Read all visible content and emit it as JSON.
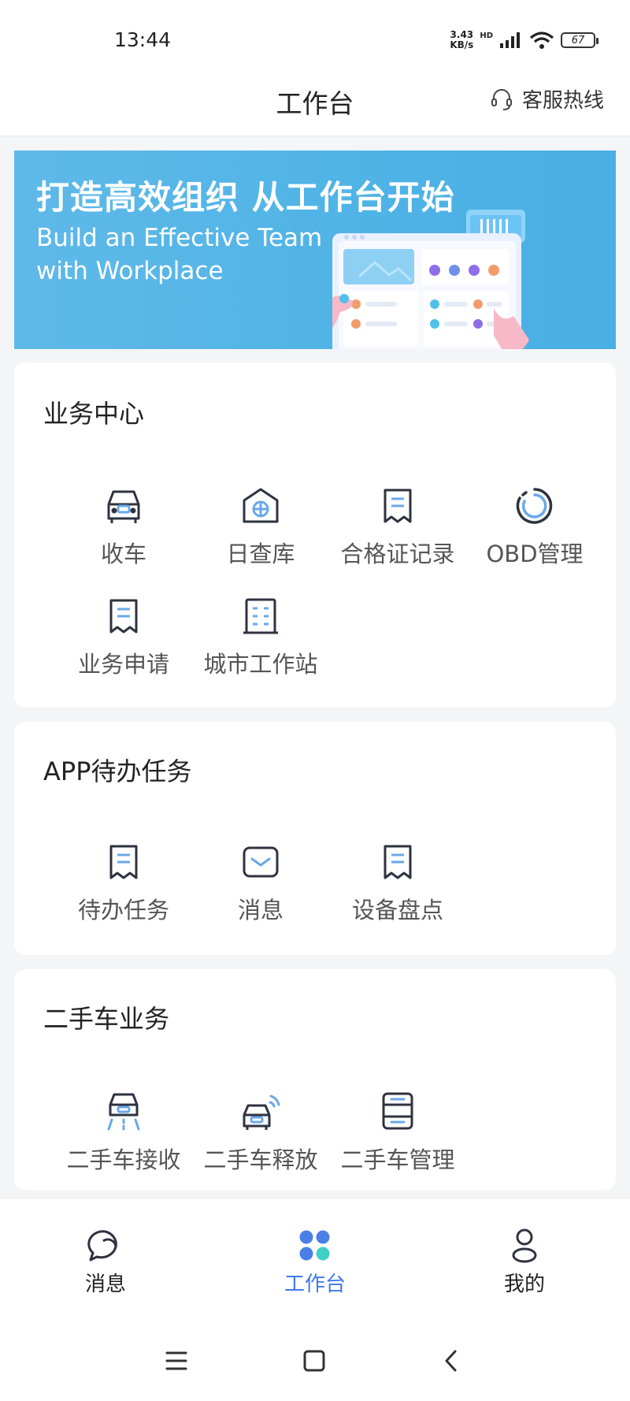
{
  "status": {
    "time": "13:44",
    "net_speed_value": "3.43",
    "net_speed_unit": "KB/s",
    "hd": "HD",
    "battery": "67"
  },
  "header": {
    "title": "工作台",
    "hotline_label": "客服热线",
    "hotline_icon": "headset-icon"
  },
  "banner": {
    "title": "打造高效组织 从工作台开始",
    "subtitle": "Build an Effective Team\nwith Workplace"
  },
  "sections": [
    {
      "title": "业务中心",
      "items": [
        {
          "label": "收车",
          "icon": "car-icon"
        },
        {
          "label": "日查库",
          "icon": "warehouse-icon"
        },
        {
          "label": "合格证记录",
          "icon": "document-icon"
        },
        {
          "label": "OBD管理",
          "icon": "obd-ring-icon"
        },
        {
          "label": "业务申请",
          "icon": "document-icon"
        },
        {
          "label": "城市工作站",
          "icon": "building-icon"
        }
      ]
    },
    {
      "title": "APP待办任务",
      "items": [
        {
          "label": "待办任务",
          "icon": "document-icon"
        },
        {
          "label": "消息",
          "icon": "mail-icon"
        },
        {
          "label": "设备盘点",
          "icon": "document-icon"
        }
      ]
    },
    {
      "title": "二手车业务",
      "items": [
        {
          "label": "二手车接收",
          "icon": "car-receive-icon"
        },
        {
          "label": "二手车释放",
          "icon": "car-signal-icon"
        },
        {
          "label": "二手车管理",
          "icon": "server-icon"
        }
      ]
    }
  ],
  "bottom_nav": [
    {
      "label": "消息",
      "icon": "chat-icon",
      "active": false
    },
    {
      "label": "工作台",
      "icon": "grid-icon",
      "active": true
    },
    {
      "label": "我的",
      "icon": "user-icon",
      "active": false
    }
  ],
  "colors": {
    "accent": "#3f7ae8",
    "icon_accent": "#6aa8e8",
    "banner": "#4fb3e6"
  }
}
